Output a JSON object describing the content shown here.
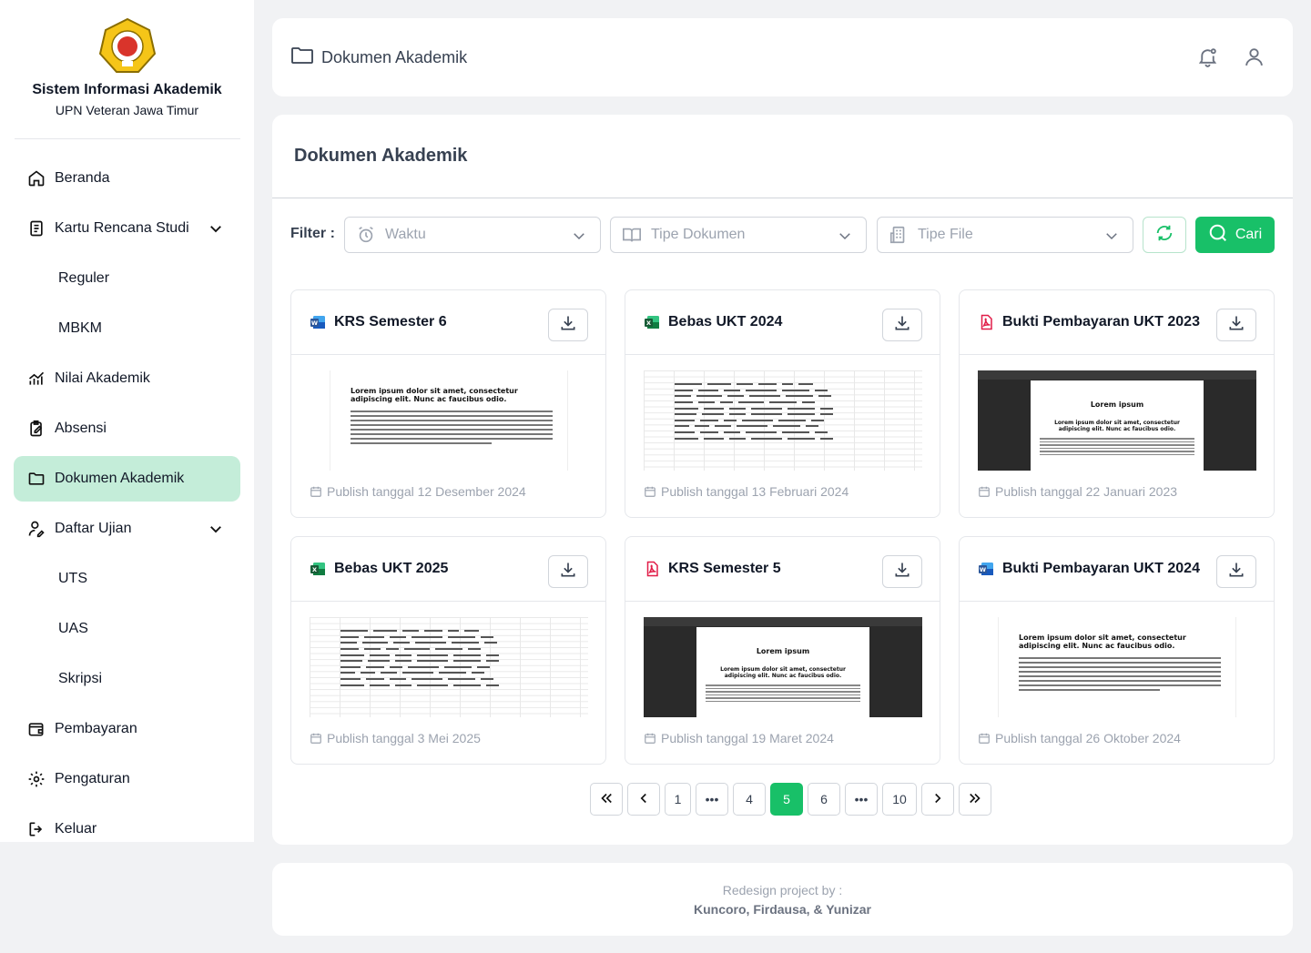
{
  "brand": {
    "title": "Sistem Informasi Akademik",
    "subtitle": "UPN Veteran Jawa Timur"
  },
  "sidebar": {
    "items": [
      {
        "label": "Beranda",
        "icon": "home-icon"
      },
      {
        "label": "Kartu Rencana Studi",
        "icon": "document-icon"
      },
      {
        "label": "Reguler"
      },
      {
        "label": "MBKM"
      },
      {
        "label": "Nilai Akademik",
        "icon": "chart-icon"
      },
      {
        "label": "Absensi",
        "icon": "clipboard-edit-icon"
      },
      {
        "label": "Dokumen Akademik",
        "icon": "folder-icon"
      },
      {
        "label": "Daftar Ujian",
        "icon": "user-edit-icon"
      },
      {
        "label": "UTS"
      },
      {
        "label": "UAS"
      },
      {
        "label": "Skripsi"
      },
      {
        "label": "Pembayaran",
        "icon": "wallet-icon"
      },
      {
        "label": "Pengaturan",
        "icon": "gear-icon"
      },
      {
        "label": "Keluar",
        "icon": "logout-icon"
      }
    ],
    "active_color": "#c4edd9"
  },
  "header": {
    "title": "Dokumen Akademik"
  },
  "main": {
    "title": "Dokumen Akademik",
    "filter_label": "Filter :",
    "filters": {
      "waktu": "Waktu",
      "tipe_dokumen": "Tipe Dokumen",
      "tipe_file": "Tipe File"
    },
    "search_label": "Cari",
    "accent": "#18c068"
  },
  "documents": [
    {
      "title": "KRS Semester 6",
      "type": "word",
      "date": "Publish tanggal 12 Desember 2024"
    },
    {
      "title": "Bebas UKT 2024",
      "type": "excel",
      "date": "Publish tanggal 13 Februari 2024"
    },
    {
      "title": "Bukti Pembayaran UKT 2023",
      "type": "pdf",
      "date": "Publish tanggal 22 Januari 2023"
    },
    {
      "title": "Bebas UKT 2025",
      "type": "excel",
      "date": "Publish tanggal 3 Mei 2025"
    },
    {
      "title": "KRS Semester 5",
      "type": "pdf",
      "date": "Publish tanggal 19 Maret 2024"
    },
    {
      "title": "Bukti Pembayaran UKT 2024",
      "type": "word",
      "date": "Publish tanggal 26 Oktober 2024"
    }
  ],
  "preview_text": {
    "word_heading": "Lorem ipsum dolor sit amet, consectetur adipiscing elit. Nunc ac faucibus odio.",
    "pdf_heading": "Lorem ipsum",
    "pdf_sub": "Lorem ipsum dolor sit amet, consectetur adipiscing elit. Nunc ac faucibus odio."
  },
  "pagination": {
    "pages": [
      "1",
      "•••",
      "4",
      "5",
      "6",
      "•••",
      "10"
    ],
    "current": "5"
  },
  "footer": {
    "line1": "Redesign project by :",
    "line2": "Kuncoro, Firdausa, & Yunizar"
  }
}
